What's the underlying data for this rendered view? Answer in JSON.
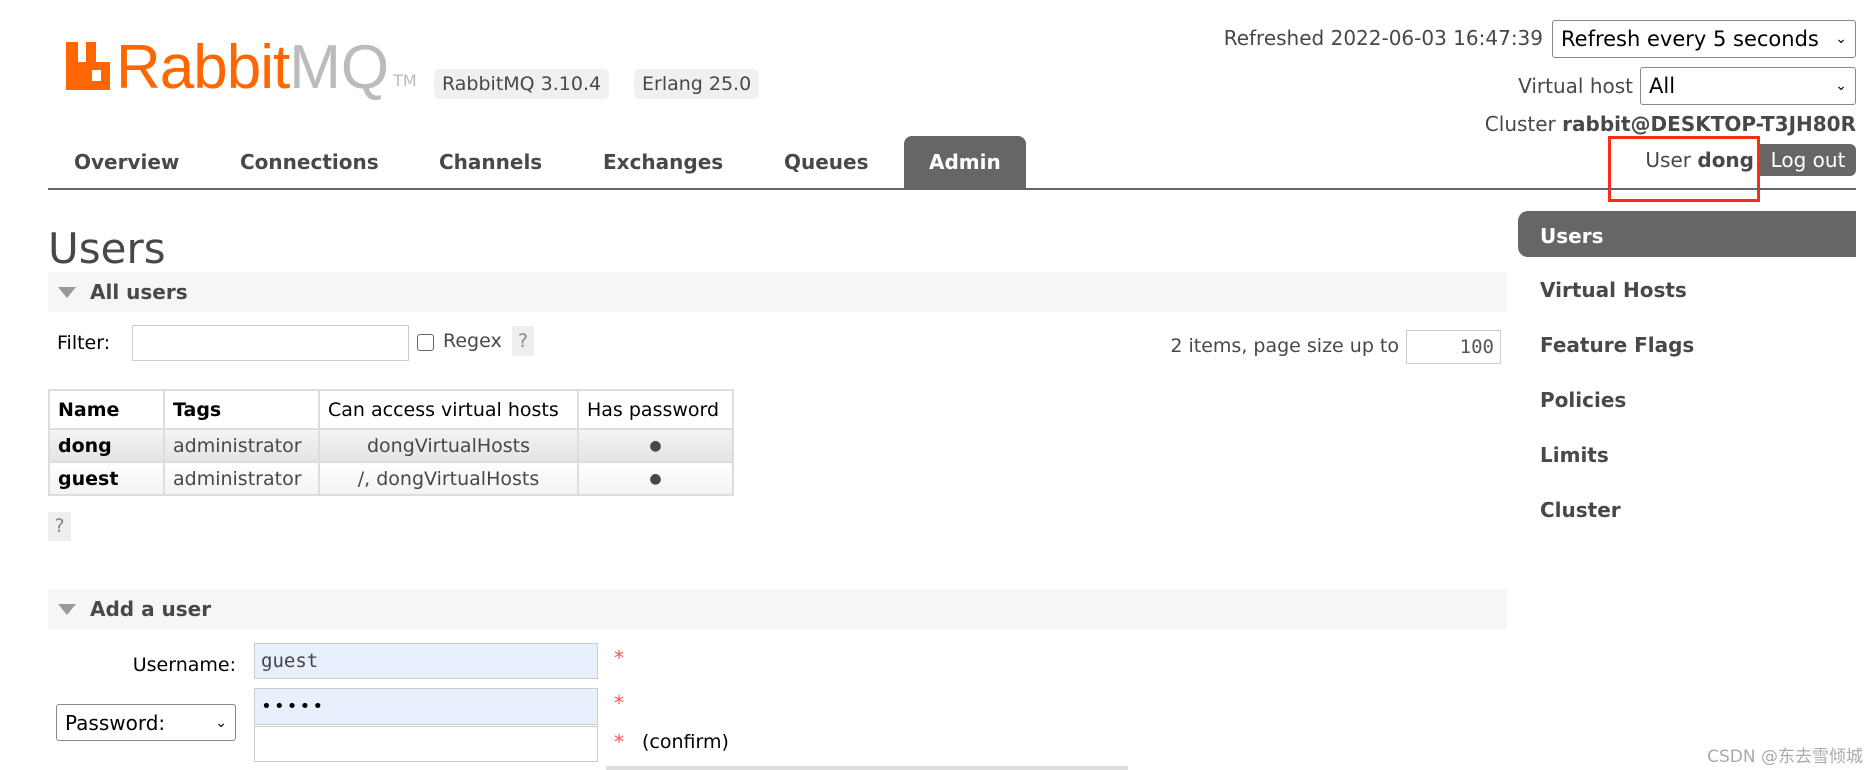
{
  "header": {
    "logo_text_orange": "Rabbit",
    "logo_text_gray": "MQ",
    "logo_tm": "TM",
    "version_badge": "RabbitMQ 3.10.4",
    "erlang_badge": "Erlang 25.0",
    "refreshed": "Refreshed 2022-06-03 16:47:39",
    "refresh_select": "Refresh every 5 seconds",
    "vhost_label": "Virtual host",
    "vhost_select": "All",
    "cluster_label": "Cluster ",
    "cluster_name": "rabbit@DESKTOP-T3JH80R",
    "user_label": "User ",
    "user_name": "dong",
    "logout": "Log out",
    "brand_color": "#ff6600",
    "highlight_color": "#ff2a1a"
  },
  "nav": {
    "tabs": [
      {
        "label": "Overview"
      },
      {
        "label": "Connections"
      },
      {
        "label": "Channels"
      },
      {
        "label": "Exchanges"
      },
      {
        "label": "Queues"
      },
      {
        "label": "Admin",
        "active": true
      }
    ]
  },
  "page_title": "Users",
  "all_users": {
    "section_title": "All users",
    "filter_label": "Filter:",
    "filter_value": "",
    "regex_label": "Regex",
    "help": "?",
    "items_text": "2 items, page size up to",
    "page_size": "100",
    "columns": [
      "Name",
      "Tags",
      "Can access virtual hosts",
      "Has password"
    ],
    "rows": [
      {
        "name": "dong",
        "tags": "administrator",
        "vhosts": "dongVirtualHosts",
        "has_password": "●"
      },
      {
        "name": "guest",
        "tags": "administrator",
        "vhosts": "/, dongVirtualHosts",
        "has_password": "●"
      }
    ],
    "help2": "?"
  },
  "add_user": {
    "section_title": "Add a user",
    "username_label": "Username:",
    "username_value": "guest",
    "password_select": "Password:",
    "password_value": "•••••",
    "confirm_value": "",
    "required": "*",
    "confirm_label": "(confirm)"
  },
  "sidebar": {
    "items": [
      {
        "label": "Users",
        "active": true
      },
      {
        "label": "Virtual Hosts"
      },
      {
        "label": "Feature Flags"
      },
      {
        "label": "Policies"
      },
      {
        "label": "Limits"
      },
      {
        "label": "Cluster"
      }
    ]
  },
  "watermark": "CSDN @东去雪倾城"
}
